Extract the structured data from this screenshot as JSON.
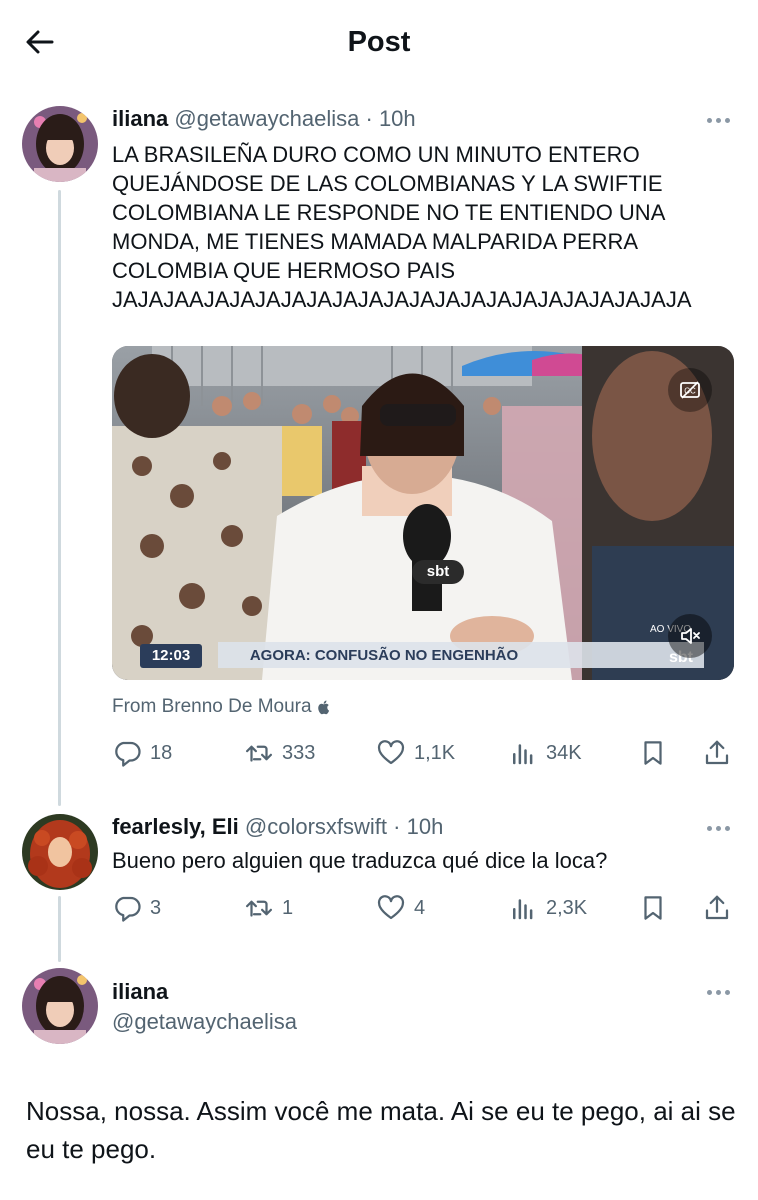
{
  "header": {
    "title": "Post",
    "back_icon": "arrow-left-icon"
  },
  "tweets": [
    {
      "name": "iliana",
      "handle": "@getawaychaelisa",
      "time": "· 10h",
      "text": "LA BRASILEÑA DURO COMO UN MINUTO ENTERO QUEJÁNDOSE DE LAS COLOMBIANAS Y LA SWIFTIE COLOMBIANA LE RESPONDE NO TE ENTIENDO UNA MONDA, ME TIENES MAMADA MALPARIDA PERRA COLOMBIA QUE HERMOSO PAIS JAJAJAAJAJAJAJAJAJAJAJAJAJAJAJAJAJAJAJAJAJAJA",
      "media": {
        "timestamp": "12:03",
        "chyron": "AGORA: CONFUSÃO NO ENGENHÃO",
        "mic_logo": "sbt",
        "channel_logo": "sbt",
        "corner_text": "AO VIVO",
        "caption_icon": "closed-captions-icon",
        "mute_icon": "speaker-muted-icon"
      },
      "source": "From Brenno De Moura",
      "source_icon": "apple-icon",
      "stats": {
        "replies": "18",
        "reposts": "333",
        "likes": "1,1K",
        "views": "34K"
      }
    },
    {
      "name": "fearlesly, Eli",
      "handle": "@colorsxfswift",
      "time": "· 10h",
      "text": "Bueno pero alguien que traduzca qué dice la loca?",
      "stats": {
        "replies": "3",
        "reposts": "1",
        "likes": "4",
        "views": "2,3K"
      }
    },
    {
      "name": "iliana",
      "handle": "@getawaychaelisa",
      "text": "Nossa, nossa. Assim você me mata. Ai se eu te pego, ai ai se eu te pego."
    }
  ],
  "colors": {
    "text": "#0f1419",
    "secondary": "#536471",
    "thread_line": "#cfd9de"
  }
}
